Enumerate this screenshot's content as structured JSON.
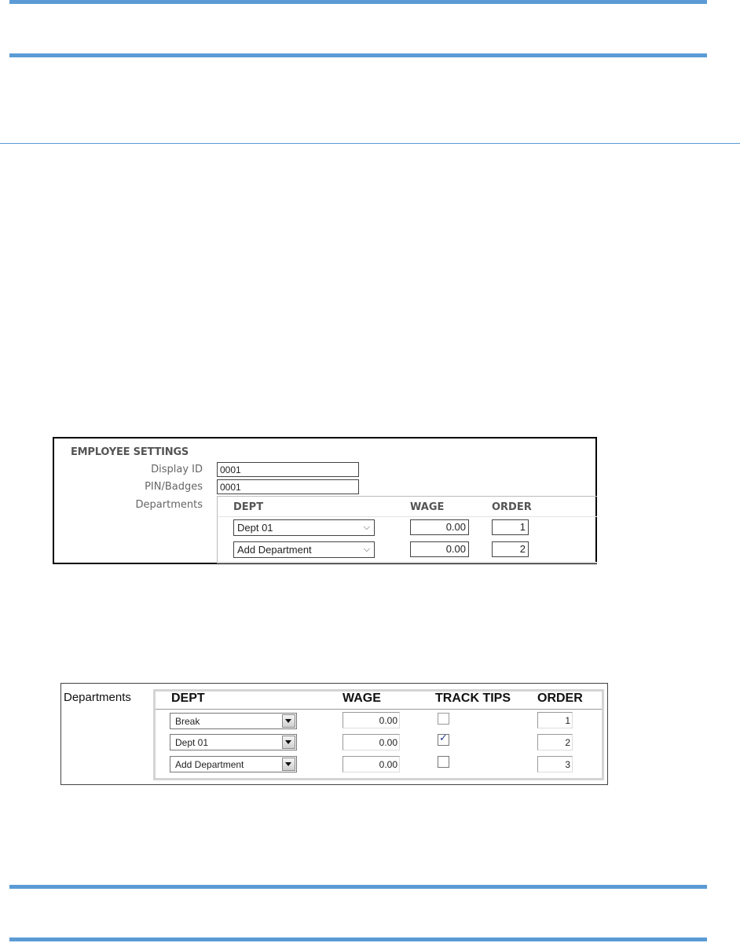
{
  "screenshot1": {
    "heading": "EMPLOYEE SETTINGS",
    "display_id_label": "Display ID",
    "display_id_value": "0001",
    "pin_label": "PIN/Badges",
    "pin_value": "0001",
    "departments_label": "Departments",
    "columns": {
      "dept": "DEPT",
      "wage": "WAGE",
      "order": "ORDER"
    },
    "rows": [
      {
        "dept": "Dept 01",
        "wage": "0.00",
        "order": "1"
      },
      {
        "dept": "Add Department",
        "wage": "0.00",
        "order": "2"
      }
    ]
  },
  "screenshot2": {
    "departments_label": "Departments",
    "columns": {
      "dept": "DEPT",
      "wage": "WAGE",
      "track_tips": "TRACK TIPS",
      "order": "ORDER"
    },
    "rows": [
      {
        "dept": "Break",
        "wage": "0.00",
        "track_tips": false,
        "order": "1"
      },
      {
        "dept": "Dept 01",
        "wage": "0.00",
        "track_tips": true,
        "order": "2"
      },
      {
        "dept": "Add Department",
        "wage": "0.00",
        "track_tips": false,
        "order": "3"
      }
    ]
  },
  "colors": {
    "rule": "#5b9bd5",
    "checkmark": "#2a3f8f"
  },
  "icons": {
    "select_arrow_1": "chevron-down-icon",
    "select_arrow_2": "dropdown-arrow-icon",
    "checkmark": "checkmark-icon"
  }
}
